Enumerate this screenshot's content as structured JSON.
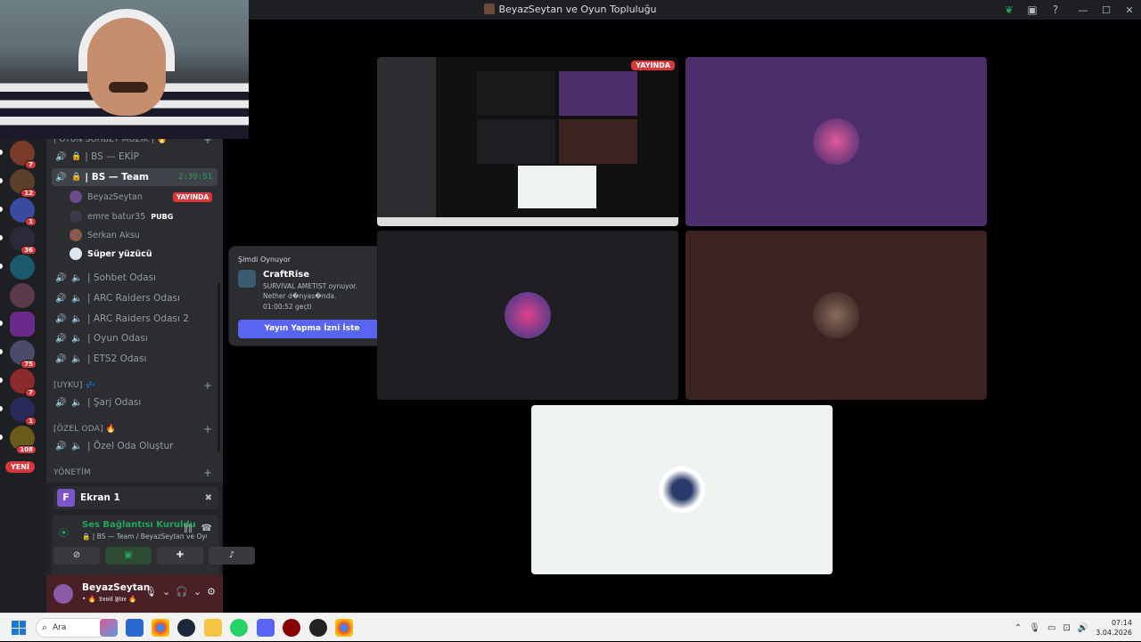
{
  "window": {
    "title": "BeyazSeytan ve Oyun Topluluğu",
    "controls": [
      "—",
      "☐",
      "✕"
    ],
    "toolbar_icons": [
      "leaf-icon",
      "screen-icon",
      "help-icon"
    ]
  },
  "servers": [
    {
      "badge": "7",
      "color": "#7a3a2a"
    },
    {
      "badge": "12",
      "color": "#5a4028"
    },
    {
      "badge": "1",
      "color": "#3a4aa0"
    },
    {
      "badge": "36",
      "color": "#2a2a3a"
    },
    {
      "badge": "",
      "color": "#1a5a6a"
    },
    {
      "badge": "",
      "color": "#5a3a4a"
    },
    {
      "badge": "",
      "color": "#6a2a8a"
    },
    {
      "badge": "75",
      "color": "#4a4a6a"
    },
    {
      "badge": "7",
      "color": "#8a2a2a"
    },
    {
      "badge": "1",
      "color": "#2a2a5a"
    },
    {
      "badge": "108",
      "color": "#6a5a1a"
    }
  ],
  "new_badge": "YENİ",
  "channels": {
    "cat_oyun": "| OYUN SOHBET MÜZİK | 🔥",
    "vc_ekip": "| BS — EKİP",
    "vc_team": "| BS — Team",
    "vc_team_timer": "2:39:51",
    "members": [
      {
        "name": "BeyazSeytan",
        "badge": "YAYINDA"
      },
      {
        "name": "emre batur35",
        "game": "PUBG"
      },
      {
        "name": "Serkan Aksu"
      },
      {
        "name": "Süper yüzücü"
      }
    ],
    "vc_sohbet": "| Sohbet Odası",
    "vc_arc": "| ARC Raiders Odası",
    "vc_arc2": "| ARC Raiders Odası 2",
    "vc_oyun": "| Oyun Odası",
    "vc_ets": "| ETS2 Odası",
    "cat_uyku": "[UYKU] 💤",
    "vc_sarj": "| Şarj Odası",
    "cat_ozel": "[ÖZEL ODA] 🔥",
    "vc_ozel": "| Özel Oda Oluştur",
    "cat_yonetim": "YÖNETİM"
  },
  "panel": {
    "screen_letter": "F",
    "screen_label": "Ekran 1",
    "voice_title": "Ses Bağlantısı Kuruldu",
    "voice_sub": "🔒 | BS — Team / BeyazSeytan ve Oyun ...",
    "user_name": "BeyazSeytan",
    "user_status": "• 🔥 𝕯𝖊𝖛𝖎𝖑 𝕱𝖎𝖗𝖊 🔥"
  },
  "popup": {
    "header": "Şimdi Oynuyor",
    "game": "CraftRise",
    "line1": "SURVIVAL AMETIST oynuyor.",
    "line2": "Nether d�nyas�nda.",
    "line3": "01:00:52 geçti",
    "button": "Yayın Yapma İzni İste"
  },
  "stream": {
    "live_label": "YAYINDA"
  },
  "taskbar": {
    "search_label": "Ara",
    "time": "07:14",
    "date": "3.04.2026"
  }
}
